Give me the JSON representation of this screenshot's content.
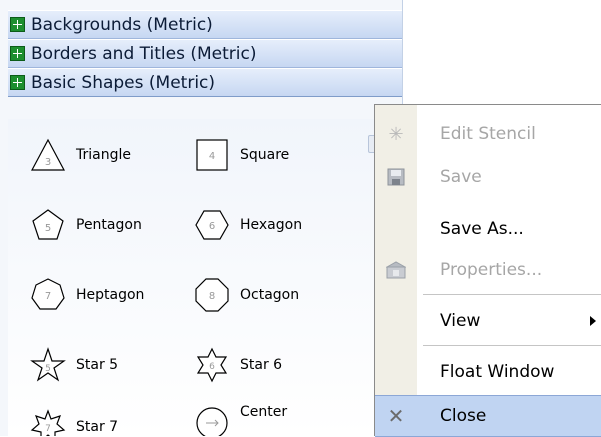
{
  "stencils": [
    {
      "title": "Backgrounds (Metric)"
    },
    {
      "title": "Borders and Titles (Metric)"
    },
    {
      "title": "Basic Shapes (Metric)"
    }
  ],
  "shapes": [
    {
      "label": "Triangle",
      "number": "3"
    },
    {
      "label": "Square",
      "number": "4"
    },
    {
      "label": "Pentagon",
      "number": "5"
    },
    {
      "label": "Hexagon",
      "number": "6"
    },
    {
      "label": "Heptagon",
      "number": "7"
    },
    {
      "label": "Octagon",
      "number": "8"
    },
    {
      "label": "Star 5",
      "number": "5"
    },
    {
      "label": "Star 6",
      "number": "6"
    },
    {
      "label": "Star 7",
      "number": "7"
    },
    {
      "label": "Center",
      "number": ""
    }
  ],
  "context_menu": {
    "items": [
      {
        "label": "Edit Stencil",
        "enabled": false,
        "icon": "edit-stencil-icon"
      },
      {
        "label": "Save",
        "enabled": false,
        "icon": "save-disk-icon"
      },
      {
        "label": "Save As...",
        "enabled": true,
        "icon": ""
      },
      {
        "label": "Properties...",
        "enabled": false,
        "icon": "properties-icon"
      },
      {
        "label": "View",
        "enabled": true,
        "icon": "",
        "submenu": true
      },
      {
        "label": "Float Window",
        "enabled": true,
        "icon": ""
      },
      {
        "label": "Close",
        "enabled": true,
        "icon": "close-icon",
        "highlighted": true
      }
    ]
  },
  "colors": {
    "header_bg": "#c6d7f2",
    "stencil_icon": "#1d8f2f",
    "menu_highlight": "#c0d4f2",
    "disabled_text": "#a6a6a6"
  }
}
